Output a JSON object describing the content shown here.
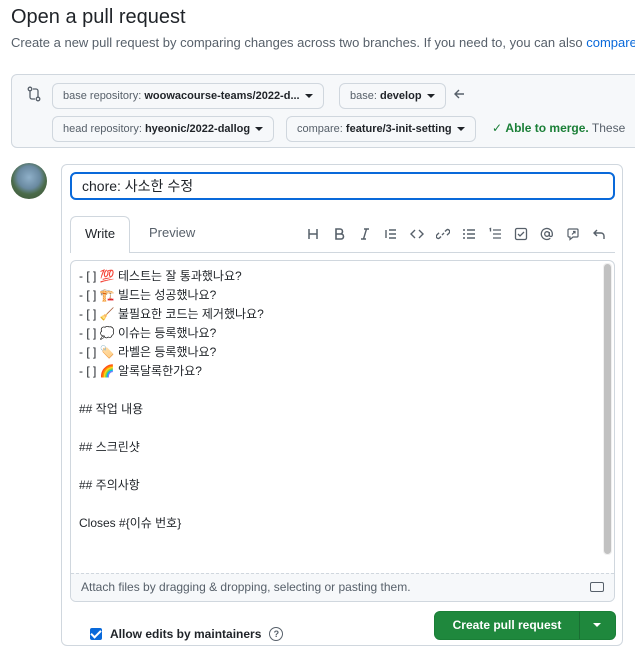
{
  "header": {
    "title": "Open a pull request",
    "subtitle": "Create a new pull request by comparing changes across two branches. If you need to, you can also ",
    "subtitle_link": "compare"
  },
  "compare": {
    "base_repo_label": "base repository: ",
    "base_repo_value": "woowacourse-teams/2022-d...",
    "base_label": "base: ",
    "base_value": "develop",
    "head_repo_label": "head repository: ",
    "head_repo_value": "hyeonic/2022-dallog",
    "compare_label": "compare: ",
    "compare_value": "feature/3-init-setting",
    "merge_status": "Able to merge.",
    "merge_extra": "These"
  },
  "editor": {
    "title_value": "chore: 사소한 수정",
    "tabs": [
      {
        "label": "Write",
        "active": true
      },
      {
        "label": "Preview",
        "active": false
      }
    ],
    "toolbar_icons": [
      "heading-icon",
      "bold-icon",
      "italic-icon",
      "quote-icon",
      "code-icon",
      "link-icon",
      "unordered-list-icon",
      "ordered-list-icon",
      "task-list-icon",
      "mention-icon",
      "reference-icon",
      "undo-icon"
    ],
    "body": "- [ ] 💯 테스트는 잘 통과했나요?\n- [ ] 🏗️ 빌드는 성공했나요?\n- [ ] 🧹 불필요한 코드는 제거했나요?\n- [ ] 💭 이슈는 등록했나요?\n- [ ] 🏷️ 라벨은 등록했나요?\n- [ ] 🌈 알록달록한가요?\n\n## 작업 내용\n\n## 스크린샷\n\n## 주의사항\n\nCloses #{이슈 번호}",
    "attach_text": "Attach files by dragging & dropping, selecting or pasting them."
  },
  "footer": {
    "allow_edits_label": "Allow edits by maintainers",
    "help_glyph": "?",
    "create_button": "Create pull request"
  },
  "colors": {
    "accent": "#0969da",
    "success": "#1f883d",
    "border": "#d0d7de"
  }
}
